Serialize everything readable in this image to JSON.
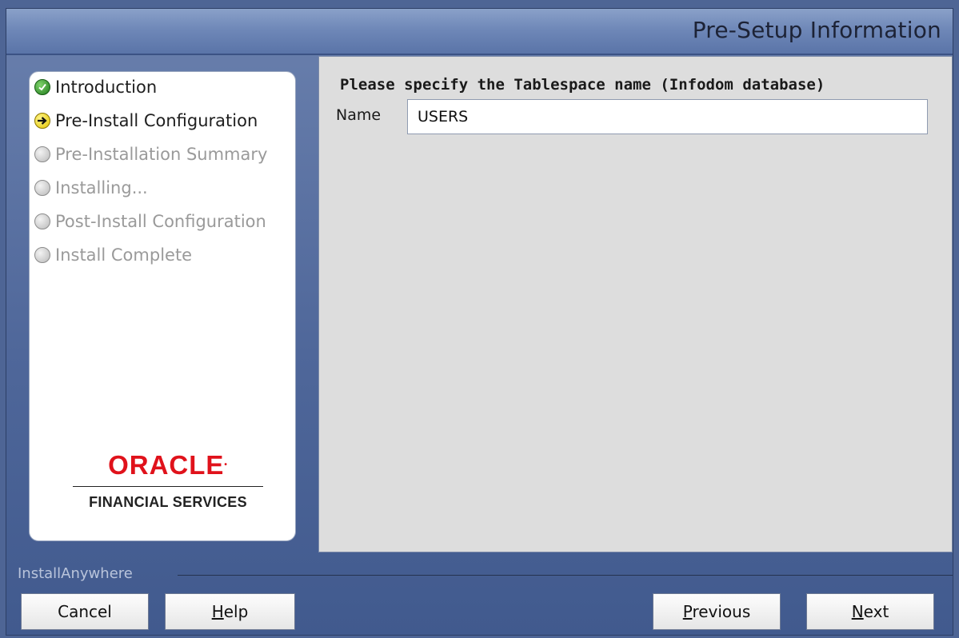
{
  "window": {
    "title": "Pre-Setup Information"
  },
  "steps": [
    {
      "label": "Introduction",
      "state": "done",
      "icon": "check-circle-icon"
    },
    {
      "label": "Pre-Install Configuration",
      "state": "current",
      "icon": "arrow-circle-icon"
    },
    {
      "label": "Pre-Installation Summary",
      "state": "pending",
      "icon": "empty-circle-icon"
    },
    {
      "label": "Installing...",
      "state": "pending",
      "icon": "empty-circle-icon"
    },
    {
      "label": "Post-Install Configuration",
      "state": "pending",
      "icon": "empty-circle-icon"
    },
    {
      "label": "Install Complete",
      "state": "pending",
      "icon": "empty-circle-icon"
    }
  ],
  "logo": {
    "wordmark": "ORACLE",
    "subtitle": "FINANCIAL SERVICES"
  },
  "form": {
    "prompt": "Please specify the Tablespace name (Infodom database)",
    "name_label": "Name",
    "name_value": "USERS"
  },
  "footer": {
    "brand": "InstallAnywhere"
  },
  "buttons": {
    "cancel": "Cancel",
    "help_mnemonic": "H",
    "help_rest": "elp",
    "previous_mnemonic": "P",
    "previous_rest": "revious",
    "next_mnemonic": "N",
    "next_rest": "ext"
  },
  "colors": {
    "accent_oracle": "#e0121b",
    "header_bg": "#6f88b8",
    "panel_bg": "#dddddd"
  }
}
